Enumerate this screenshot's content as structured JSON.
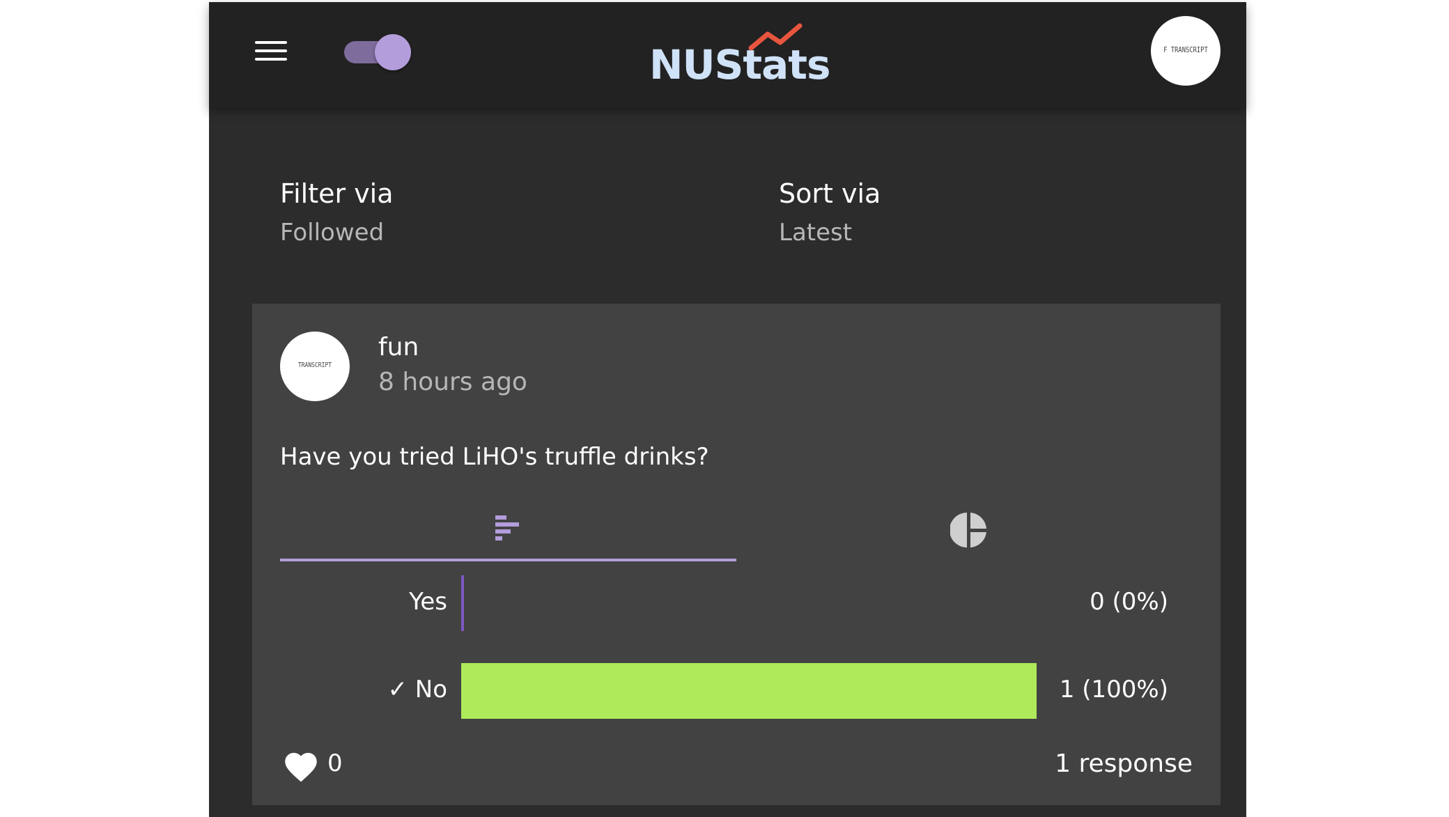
{
  "header": {
    "logo": "NUStats",
    "logo_accent": "#e8553e",
    "avatar_text": "F TRANSCRIPT"
  },
  "controls": {
    "filter_label": "Filter via",
    "filter_value": "Followed",
    "sort_label": "Sort via",
    "sort_value": "Latest"
  },
  "post": {
    "author": "fun",
    "time": "8 hours ago",
    "avatar_text": "TRANSCRIPT",
    "question": "Have you tried LiHO's truffle drinks?",
    "tabs": [
      {
        "icon": "bar-chart-icon",
        "active": true
      },
      {
        "icon": "pie-chart-icon",
        "active": false
      }
    ],
    "likes": "0",
    "responses": "1 response"
  },
  "chart_data": {
    "type": "bar",
    "orientation": "horizontal",
    "categories": [
      "Yes",
      "✓ No"
    ],
    "values": [
      0,
      1
    ],
    "value_labels": [
      "0 (0%)",
      "1 (100%)"
    ],
    "percent": [
      0,
      100
    ],
    "colors": [
      "#7e57c2",
      "#aeea5a"
    ]
  },
  "colors": {
    "accent": "#b39ddb",
    "app_bg": "#2c2c2c",
    "card_bg": "#424242"
  }
}
